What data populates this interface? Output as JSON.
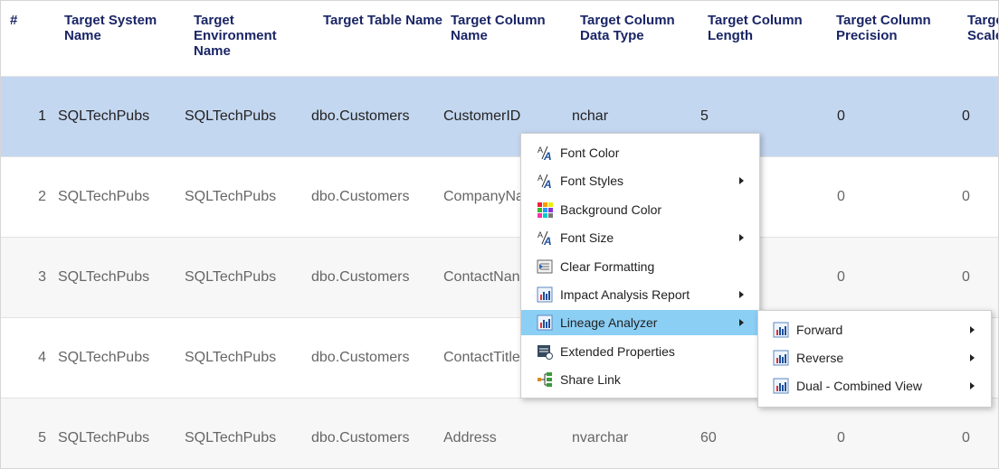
{
  "table": {
    "headers": [
      {
        "key": "num",
        "label": "#"
      },
      {
        "key": "system",
        "label": "Target System Name"
      },
      {
        "key": "env",
        "label": "Target Environment Name"
      },
      {
        "key": "tbl",
        "label": "Target Table Name"
      },
      {
        "key": "col",
        "label": "Target Column Name"
      },
      {
        "key": "dtype",
        "label": "Target Column Data Type"
      },
      {
        "key": "len",
        "label": "Target Column Length"
      },
      {
        "key": "prec",
        "label": "Target Column Precision"
      },
      {
        "key": "scale",
        "label": "Target Column Scale"
      }
    ],
    "rows": [
      {
        "num": "1",
        "system": "SQLTechPubs",
        "env": "SQLTechPubs",
        "tbl": "dbo.Customers",
        "col": "CustomerID",
        "dtype": "nchar",
        "len": "5",
        "prec": "0",
        "scale": "0",
        "selected": true
      },
      {
        "num": "2",
        "system": "SQLTechPubs",
        "env": "SQLTechPubs",
        "tbl": "dbo.Customers",
        "col": "CompanyNa",
        "dtype": "",
        "len": "",
        "prec": "0",
        "scale": "0",
        "selected": false
      },
      {
        "num": "3",
        "system": "SQLTechPubs",
        "env": "SQLTechPubs",
        "tbl": "dbo.Customers",
        "col": "ContactNan",
        "dtype": "",
        "len": "",
        "prec": "0",
        "scale": "0",
        "selected": false
      },
      {
        "num": "4",
        "system": "SQLTechPubs",
        "env": "SQLTechPubs",
        "tbl": "dbo.Customers",
        "col": "ContactTitle",
        "dtype": "",
        "len": "",
        "prec": "0",
        "scale": "0",
        "selected": false
      },
      {
        "num": "5",
        "system": "SQLTechPubs",
        "env": "SQLTechPubs",
        "tbl": "dbo.Customers",
        "col": "Address",
        "dtype": "nvarchar",
        "len": "60",
        "prec": "0",
        "scale": "0",
        "selected": false
      }
    ]
  },
  "context_menu": {
    "items": [
      {
        "label": "Font Color",
        "icon": "font-color-icon",
        "submenu": false
      },
      {
        "label": "Font Styles",
        "icon": "font-styles-icon",
        "submenu": true
      },
      {
        "label": "Background Color",
        "icon": "background-color-icon",
        "submenu": false
      },
      {
        "label": "Font Size",
        "icon": "font-size-icon",
        "submenu": true
      },
      {
        "label": "Clear Formatting",
        "icon": "clear-formatting-icon",
        "submenu": false
      },
      {
        "label": "Impact Analysis Report",
        "icon": "impact-analysis-icon",
        "submenu": true
      },
      {
        "label": "Lineage Analyzer",
        "icon": "lineage-analyzer-icon",
        "submenu": true,
        "active": true
      },
      {
        "label": "Extended Properties",
        "icon": "extended-properties-icon",
        "submenu": false
      },
      {
        "label": "Share Link",
        "icon": "share-link-icon",
        "submenu": false
      }
    ]
  },
  "lineage_submenu": {
    "items": [
      {
        "label": "Forward",
        "icon": "forward-lineage-icon",
        "submenu": true
      },
      {
        "label": "Reverse",
        "icon": "reverse-lineage-icon",
        "submenu": true
      },
      {
        "label": "Dual - Combined View",
        "icon": "dual-lineage-icon",
        "submenu": true
      }
    ]
  },
  "colors": {
    "selected_row": "#c4d7f0",
    "header_text": "#1a2566",
    "menu_highlight": "#8ccff5"
  }
}
